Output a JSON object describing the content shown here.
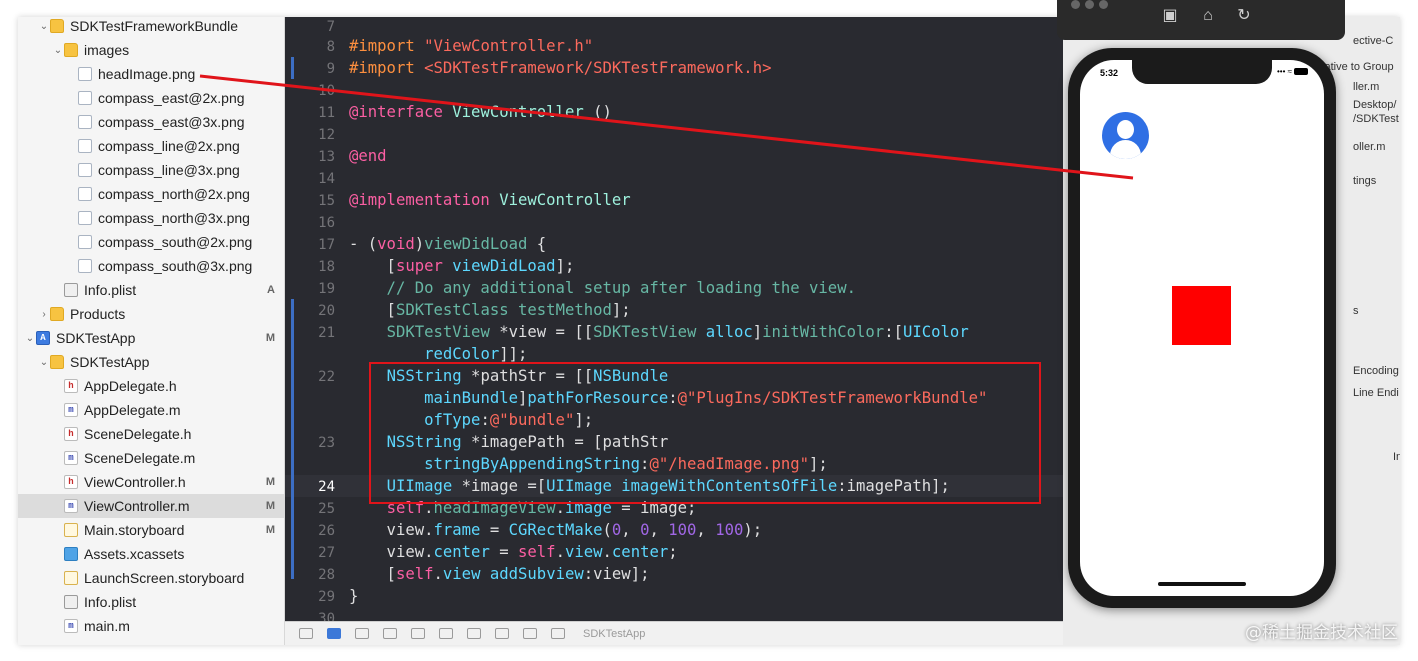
{
  "navigator": {
    "items": [
      {
        "label": "SDKTestFrameworkBundle",
        "icon": "folder-icon",
        "disclosure": "v",
        "badge": ""
      },
      {
        "label": "images",
        "icon": "folder-icon",
        "disclosure": "v",
        "badge": ""
      },
      {
        "label": "headImage.png",
        "icon": "image-file-icon",
        "disclosure": "",
        "badge": ""
      },
      {
        "label": "compass_east@2x.png",
        "icon": "image-file-icon",
        "disclosure": "",
        "badge": ""
      },
      {
        "label": "compass_east@3x.png",
        "icon": "image-file-icon",
        "disclosure": "",
        "badge": ""
      },
      {
        "label": "compass_line@2x.png",
        "icon": "image-file-icon",
        "disclosure": "",
        "badge": ""
      },
      {
        "label": "compass_line@3x.png",
        "icon": "image-file-icon",
        "disclosure": "",
        "badge": ""
      },
      {
        "label": "compass_north@2x.png",
        "icon": "image-file-icon",
        "disclosure": "",
        "badge": ""
      },
      {
        "label": "compass_north@3x.png",
        "icon": "image-file-icon",
        "disclosure": "",
        "badge": ""
      },
      {
        "label": "compass_south@2x.png",
        "icon": "image-file-icon",
        "disclosure": "",
        "badge": ""
      },
      {
        "label": "compass_south@3x.png",
        "icon": "image-file-icon",
        "disclosure": "",
        "badge": ""
      },
      {
        "label": "Info.plist",
        "icon": "plist-file-icon",
        "disclosure": "",
        "badge": "A"
      },
      {
        "label": "Products",
        "icon": "folder-icon",
        "disclosure": ">",
        "badge": ""
      },
      {
        "label": "SDKTestApp",
        "icon": "project-icon",
        "disclosure": "v",
        "badge": "M"
      },
      {
        "label": "SDKTestApp",
        "icon": "folder-icon",
        "disclosure": "v",
        "badge": ""
      },
      {
        "label": "AppDelegate.h",
        "icon": "header-file-icon",
        "disclosure": "",
        "badge": ""
      },
      {
        "label": "AppDelegate.m",
        "icon": "objc-file-icon",
        "disclosure": "",
        "badge": ""
      },
      {
        "label": "SceneDelegate.h",
        "icon": "header-file-icon",
        "disclosure": "",
        "badge": ""
      },
      {
        "label": "SceneDelegate.m",
        "icon": "objc-file-icon",
        "disclosure": "",
        "badge": ""
      },
      {
        "label": "ViewController.h",
        "icon": "header-file-icon",
        "disclosure": "",
        "badge": "M"
      },
      {
        "label": "ViewController.m",
        "icon": "objc-file-icon",
        "disclosure": "",
        "badge": "M"
      },
      {
        "label": "Main.storyboard",
        "icon": "storyboard-icon",
        "disclosure": "",
        "badge": "M"
      },
      {
        "label": "Assets.xcassets",
        "icon": "assets-icon",
        "disclosure": "",
        "badge": ""
      },
      {
        "label": "LaunchScreen.storyboard",
        "icon": "storyboard-icon",
        "disclosure": "",
        "badge": ""
      },
      {
        "label": "Info.plist",
        "icon": "plist-file-icon",
        "disclosure": "",
        "badge": ""
      },
      {
        "label": "main.m",
        "icon": "objc-file-icon",
        "disclosure": "",
        "badge": ""
      }
    ],
    "selected_index": 20
  },
  "editor": {
    "line_numbers": [
      "7",
      "8",
      "9",
      "10",
      "11",
      "12",
      "13",
      "14",
      "15",
      "16",
      "17",
      "18",
      "19",
      "20",
      "21",
      "22",
      "23",
      "24",
      "25",
      "26",
      "27",
      "28",
      "29",
      "30"
    ],
    "current_line": "24",
    "lines": {
      "l8": {
        "a": "#import ",
        "b": "\"ViewController.h\""
      },
      "l9": {
        "a": "#import ",
        "b": "<SDKTestFramework/SDKTestFramework.h>"
      },
      "l11": {
        "a": "@interface ",
        "b": "ViewController",
        "c": " ()"
      },
      "l13": "@end",
      "l15": {
        "a": "@implementation ",
        "b": "ViewController"
      },
      "l17": {
        "a": "- (",
        "b": "void",
        "c": ")",
        "d": "viewDidLoad",
        "e": " {"
      },
      "l18": {
        "a": "    [",
        "b": "super",
        "c": " ",
        "d": "viewDidLoad",
        "e": "];"
      },
      "l19": "    // Do any additional setup after loading the view.",
      "l20": {
        "a": "    [",
        "b": "SDKTestClass",
        "c": " ",
        "d": "testMethod",
        "e": "];"
      },
      "l21a": {
        "a": "    ",
        "b": "SDKTestView",
        "c": " *view = [[",
        "d": "SDKTestView",
        "e": " ",
        "f": "alloc",
        "g": "]",
        "h": "initWithColor",
        "i": ":[",
        "j": "UIColor"
      },
      "l21b": {
        "a": "        ",
        "b": "redColor",
        "c": "]];"
      },
      "l22a": {
        "a": "    ",
        "b": "NSString",
        "c": " *pathStr = [[",
        "d": "NSBundle"
      },
      "l22b": {
        "a": "        ",
        "b": "mainBundle",
        "c": "]",
        "d": "pathForResource",
        "e": ":",
        "f": "@\"PlugIns/SDKTestFrameworkBundle\""
      },
      "l22c": {
        "a": "        ",
        "b": "ofType",
        "c": ":",
        "d": "@\"bundle\"",
        "e": "];"
      },
      "l23a": {
        "a": "    ",
        "b": "NSString",
        "c": " *imagePath = [pathStr"
      },
      "l23b": {
        "a": "        ",
        "b": "stringByAppendingString",
        "c": ":",
        "d": "@\"/headImage.png\"",
        "e": "];"
      },
      "l24": {
        "a": "    ",
        "b": "UIImage",
        "c": " *image =[",
        "d": "UIImage",
        "e": " ",
        "f": "imageWithContentsOfFile",
        "g": ":imagePath];"
      },
      "l25": {
        "a": "    ",
        "b": "self",
        "c": ".",
        "d": "headImageView",
        "e": ".",
        "f": "image",
        "g": " = image;"
      },
      "l26": {
        "a": "    view.",
        "b": "frame",
        "c": " = ",
        "d": "CGRectMake",
        "e": "(",
        "f": "0",
        "g": ", ",
        "h": "0",
        "i": ", ",
        "j": "100",
        "k": ", ",
        "l": "100",
        "m": ");"
      },
      "l27": {
        "a": "    view.",
        "b": "center",
        "c": " = ",
        "d": "self",
        "e": ".",
        "f": "view",
        "g": ".",
        "h": "center",
        "i": ";"
      },
      "l28": {
        "a": "    [",
        "b": "self",
        "c": ".",
        "d": "view",
        "e": " ",
        "f": "addSubview",
        "g": ":view];"
      },
      "l29": "}"
    }
  },
  "debug_bar": {
    "scheme": "SDKTestApp"
  },
  "inspector": {
    "fragments": [
      "ective-C",
      "Relative to Group",
      "ller.m",
      "Desktop/",
      "/SDKTest",
      "oller.m",
      "tings",
      "s",
      "Encoding",
      "Line Endi",
      "In"
    ]
  },
  "simulator": {
    "status_time": "5:32",
    "icons": [
      "screenshot-icon",
      "home-icon",
      "rotate-icon"
    ]
  },
  "watermark": "@稀土掘金技术社区",
  "colors": {
    "annotation": "#e0141a",
    "editor_bg": "#292a30",
    "red_view": "#ff0000",
    "avatar_blue": "#2f6fe4"
  }
}
